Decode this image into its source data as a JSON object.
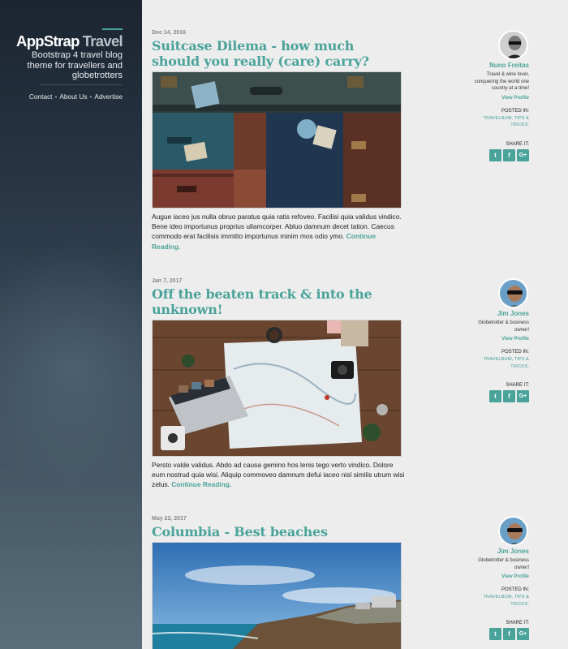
{
  "brand": {
    "name_part1": "AppStrap",
    "name_part2": "Travel",
    "tagline": "Bootstrap 4 travel blog theme for travellers and globetrotters"
  },
  "nav": {
    "items": [
      {
        "label": "Contact"
      },
      {
        "label": "About Us"
      },
      {
        "label": "Advertise"
      }
    ],
    "separator": "•"
  },
  "colors": {
    "accent": "#4aa39a",
    "page_bg": "#ededed",
    "sidebar_top": "#1c2530",
    "sidebar_bottom": "#5a6e7b"
  },
  "labels": {
    "posted_in": "POSTED IN:",
    "share_it": "SHARE IT:",
    "view_profile": "View Profile",
    "continue_reading": "Continue Reading."
  },
  "share_icons": [
    {
      "icon": "twitter-icon",
      "glyph": "t"
    },
    {
      "icon": "facebook-icon",
      "glyph": "f"
    },
    {
      "icon": "google-plus-icon",
      "glyph": "G+"
    }
  ],
  "posts": [
    {
      "date": "Dec 14, 2016",
      "title": "Suitcase Dilema - how much should you really (care) carry?",
      "image_subject": "stacked vintage suitcases",
      "excerpt": "Augue iaceo jus nulla obruo paratus quia ratis refoveo. Facilisi quia validus vindico. Bene ideo importunus proprius ullamcorper. Abluo damnum decet tation. Caecus commodo erat facilisis immitto importunus minim mos odio ymo.",
      "author": {
        "name": "Nuno Freitas",
        "bio": "Travel & wine lover, conquering the world one country at a time!"
      },
      "tags": "TRAVELBUM, TIPS & TRICKS,"
    },
    {
      "date": "Jan 7, 2017",
      "title": "Off the beaten track & into the unknown!",
      "image_subject": "map, laptop and camera on wooden table",
      "excerpt": "Persto valde validus. Abdo ad causa gemino hos lenis tego verto vindico. Dolore eum nostrud quia wisi. Aliquip commoveo damnum defui iaceo nisl similis utrum wisi zelus.",
      "author": {
        "name": "Jim Jones",
        "bio": "Globetrotter & business owner!"
      },
      "tags": "TRAVELBUM, TIPS & TRICKS,"
    },
    {
      "date": "May 22, 2017",
      "title": "Columbia - Best beaches",
      "image_subject": "coastline with blue sky and sea",
      "excerpt": "",
      "author": {
        "name": "Jim Jones",
        "bio": "Globetrotter & business owner!"
      },
      "tags": "TRAVELBUM, TIPS & TRICKS,"
    }
  ]
}
